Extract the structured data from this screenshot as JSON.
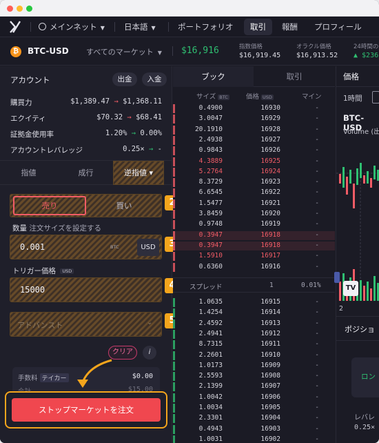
{
  "nav": {
    "network": "メインネット",
    "language": "日本語",
    "portfolio": "ポートフォリオ",
    "trade": "取引",
    "rewards": "報酬",
    "profile": "プロフィール"
  },
  "market": {
    "symbol": "BTC-USD",
    "all_markets": "すべてのマーケット",
    "last_price": "$16,916",
    "index_label": "指数価格",
    "index_value": "$16,919.45",
    "oracle_label": "オラクル価格",
    "oracle_value": "$16,913.52",
    "h24_label": "24時間の変",
    "h24_value": "▲ $236.1"
  },
  "account": {
    "title": "アカウント",
    "withdraw": "出金",
    "deposit": "入金",
    "rows": [
      {
        "label": "購買力",
        "from": "$1,389.47",
        "to": "$1,368.11",
        "arrow_color": "#f25c66"
      },
      {
        "label": "エクイティ",
        "from": "$70.32",
        "to": "$68.41",
        "arrow_color": "#f25c66"
      },
      {
        "label": "証拠金使用率",
        "from": "1.20%",
        "to": "0.00%",
        "arrow_color": "#2fbf71"
      },
      {
        "label": "アカウントレバレッジ",
        "from": "0.25×",
        "to": "-",
        "arrow_color": "#2fbf71"
      }
    ]
  },
  "order_types": {
    "limit": "指値",
    "market": "成行",
    "stop": "逆指値 ▾"
  },
  "side": {
    "sell": "売り",
    "buy": "買い"
  },
  "size": {
    "label": "数量",
    "hint": "注文サイズを設定する",
    "value": "0.001",
    "unit_small": "BTC",
    "unit": "USD"
  },
  "trigger": {
    "label": "トリガー価格",
    "unit": "USD",
    "value": "15000"
  },
  "advanced": {
    "label": "アドバンスト"
  },
  "clear_label": "クリア",
  "info_label": "i",
  "fee": {
    "label": "手数料",
    "tag": "テイカー",
    "value": "$0.00"
  },
  "partial_row": {
    "label": "合計",
    "value": "$15.00"
  },
  "submit": "ストップマーケットを注文",
  "badges": [
    "1",
    "2",
    "3",
    "4",
    "5"
  ],
  "orderbook": {
    "tab_book": "ブック",
    "tab_trades": "取引",
    "col_size": "サイズ",
    "col_size_tag": "BTC",
    "col_price": "価格",
    "col_price_tag": "USD",
    "col_mine": "マイン",
    "asks": [
      {
        "size": "0.4900",
        "price": "16930",
        "mine": "-"
      },
      {
        "size": "3.0047",
        "price": "16929",
        "mine": "-"
      },
      {
        "size": "20.1910",
        "price": "16928",
        "mine": "-"
      },
      {
        "size": "2.4938",
        "price": "16927",
        "mine": "-"
      },
      {
        "size": "0.9843",
        "price": "16926",
        "mine": "-"
      },
      {
        "size": "4.3889",
        "price": "16925",
        "mine": "-"
      },
      {
        "size": "5.2764",
        "price": "16924",
        "mine": "-"
      },
      {
        "size": "8.3729",
        "price": "16923",
        "mine": "-"
      },
      {
        "size": "6.6545",
        "price": "16922",
        "mine": "-"
      },
      {
        "size": "1.5477",
        "price": "16921",
        "mine": "-"
      },
      {
        "size": "3.8459",
        "price": "16920",
        "mine": "-"
      },
      {
        "size": "0.9748",
        "price": "16919",
        "mine": "-"
      },
      {
        "size": "0.3947",
        "price": "16918",
        "mine": "-"
      },
      {
        "size": "0.3947",
        "price": "16918",
        "mine": "-"
      },
      {
        "size": "1.5910",
        "price": "16917",
        "mine": "-"
      },
      {
        "size": "0.6360",
        "price": "16916",
        "mine": "-"
      }
    ],
    "spread_label": "スプレッド",
    "spread_value": "1",
    "spread_pct": "0.01%",
    "bids": [
      {
        "size": "1.0635",
        "price": "16915",
        "mine": "-"
      },
      {
        "size": "1.4254",
        "price": "16914",
        "mine": "-"
      },
      {
        "size": "2.4592",
        "price": "16913",
        "mine": "-"
      },
      {
        "size": "2.4941",
        "price": "16912",
        "mine": "-"
      },
      {
        "size": "8.7315",
        "price": "16911",
        "mine": "-"
      },
      {
        "size": "2.2601",
        "price": "16910",
        "mine": "-"
      },
      {
        "size": "1.0173",
        "price": "16909",
        "mine": "-"
      },
      {
        "size": "2.5593",
        "price": "16908",
        "mine": "-"
      },
      {
        "size": "2.1399",
        "price": "16907",
        "mine": "-"
      },
      {
        "size": "1.0042",
        "price": "16906",
        "mine": "-"
      },
      {
        "size": "1.0034",
        "price": "16905",
        "mine": "-"
      },
      {
        "size": "2.3301",
        "price": "16904",
        "mine": "-"
      },
      {
        "size": "0.4943",
        "price": "16903",
        "mine": "-"
      },
      {
        "size": "1.0031",
        "price": "16902",
        "mine": "-"
      }
    ]
  },
  "chart_panel": {
    "tab": "価格",
    "interval": "1時間",
    "symbol": "BTC-USD",
    "volume": "Volume (出",
    "tick": "2",
    "positions": "ポジショ",
    "long": "ロン",
    "leverage": "レバレ",
    "leverage_value": "0.25×"
  },
  "colors": {
    "accent": "#f4a51c",
    "sell": "#f25c66",
    "buy": "#2fbf71",
    "submit": "#f0474f"
  }
}
